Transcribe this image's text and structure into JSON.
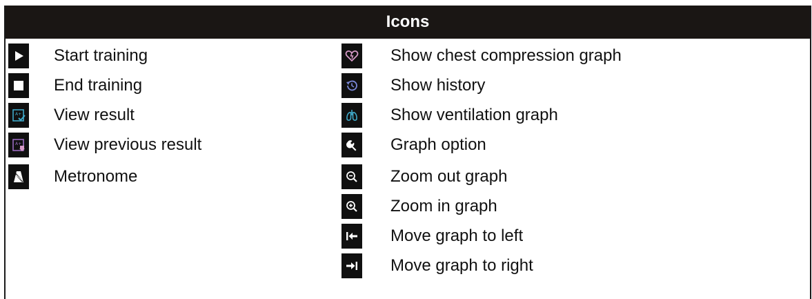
{
  "header": {
    "title": "Icons"
  },
  "left_items": [
    {
      "icon": "play-icon",
      "label": "Start training"
    },
    {
      "icon": "stop-icon",
      "label": "End training"
    },
    {
      "icon": "view-result-icon",
      "label": "View result"
    },
    {
      "icon": "view-previous-result-icon",
      "label": "View previous result"
    },
    {
      "icon": "metronome-icon",
      "label": "Metronome"
    }
  ],
  "right_items": [
    {
      "icon": "heart-icon",
      "label": "Show chest compression graph"
    },
    {
      "icon": "history-icon",
      "label": "Show history"
    },
    {
      "icon": "lungs-icon",
      "label": "Show ventilation graph"
    },
    {
      "icon": "wrench-icon",
      "label": "Graph option"
    },
    {
      "icon": "zoom-out-icon",
      "label": "Zoom out graph"
    },
    {
      "icon": "zoom-in-icon",
      "label": "Zoom in graph"
    },
    {
      "icon": "arrow-to-left-icon",
      "label": "Move graph to left"
    },
    {
      "icon": "arrow-to-right-icon",
      "label": "Move graph to right"
    }
  ],
  "colors": {
    "header_bg": "#1a1614",
    "icon_bg": "#101010",
    "teal_accent": "#3fa9c9",
    "purple_accent": "#9a6bc0",
    "pink_accent": "#d79ac8",
    "blue_accent": "#7a88d8"
  }
}
